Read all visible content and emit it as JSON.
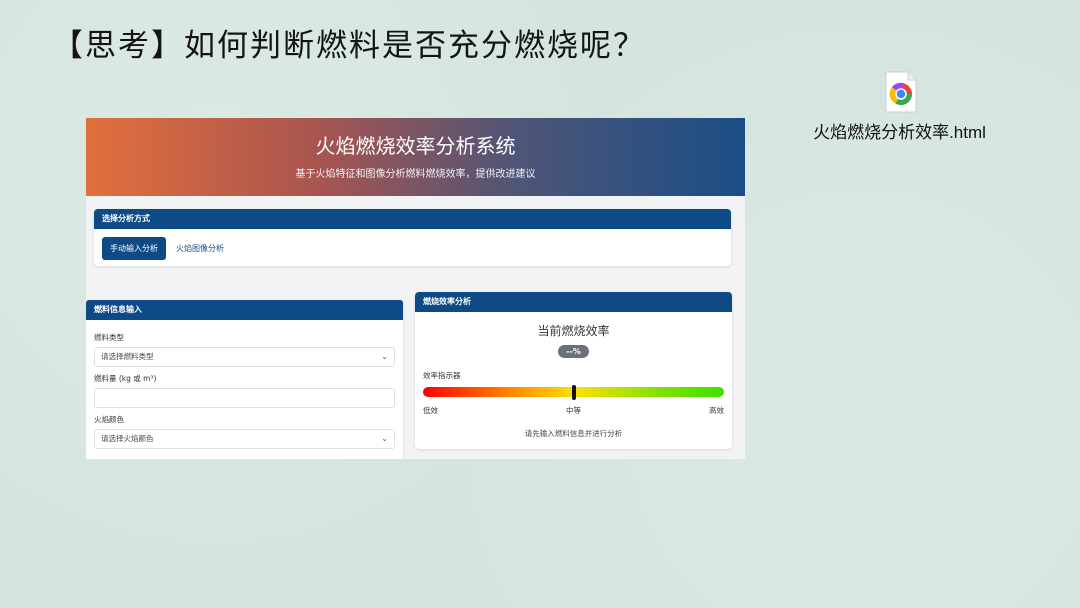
{
  "slide": {
    "title": "【思考】如何判断燃料是否充分燃烧呢？"
  },
  "file": {
    "icon": "chrome-html-file-icon",
    "name": "火焰燃烧分析效率.html"
  },
  "app": {
    "title": "火焰燃烧效率分析系统",
    "subtitle": "基于火焰特征和图像分析燃料燃烧效率，提供改进建议",
    "mode": {
      "header": "选择分析方式",
      "manual_label": "手动输入分析",
      "image_label": "火焰图像分析"
    },
    "fuel": {
      "header": "燃料信息输入",
      "type_label": "燃料类型",
      "type_value": "请选择燃料类型",
      "amount_label": "燃料量 (kg 或 m³)",
      "amount_value": "",
      "color_label": "火焰颜色",
      "color_value": "请选择火焰颜色"
    },
    "efficiency": {
      "header": "燃烧效率分析",
      "title": "当前燃烧效率",
      "value": "--%",
      "indicator_label": "效率指示器",
      "indicator_position": 0.5,
      "scale_low": "低效",
      "scale_mid": "中等",
      "scale_high": "高效",
      "hint": "请先输入燃料信息并进行分析"
    }
  },
  "colors": {
    "primary": "#0e4a86",
    "header_start": "#e36f3c",
    "header_end": "#1a4e86",
    "badge": "#6b7178"
  }
}
